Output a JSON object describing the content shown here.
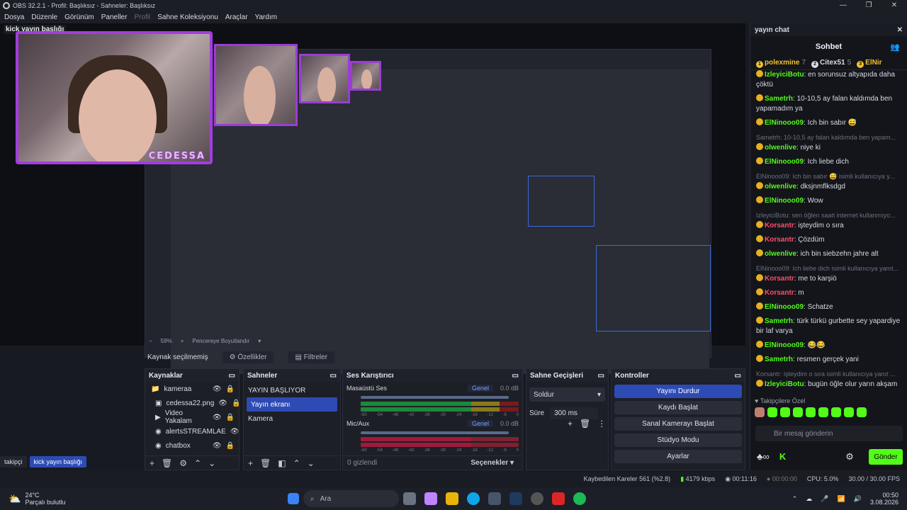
{
  "window": {
    "title": "OBS 32.2.1 - Profil: Başlıksız - Sahneler: Başlıksız",
    "controls": [
      "—",
      "❐",
      "✕"
    ]
  },
  "menu": [
    {
      "label": "Dosya",
      "disabled": false
    },
    {
      "label": "Düzenle",
      "disabled": false
    },
    {
      "label": "Görünüm",
      "disabled": false
    },
    {
      "label": "Paneller",
      "disabled": false
    },
    {
      "label": "Profil",
      "disabled": true
    },
    {
      "label": "Sahne Koleksiyonu",
      "disabled": false
    },
    {
      "label": "Araçlar",
      "disabled": false
    },
    {
      "label": "Yardım",
      "disabled": false
    }
  ],
  "preview": {
    "label": "kick yayın başlığı",
    "webcam_tag": "CEDESSA",
    "zoom": "59%",
    "fit": "Pencereye Boyutlandır"
  },
  "source_bar": {
    "status": "Kaynak seçilmemiş",
    "properties": "Özellikler",
    "filters": "Filtreler"
  },
  "sources": {
    "title": "Kaynaklar",
    "items": [
      {
        "name": "kameraa",
        "icon": "folder-icon"
      },
      {
        "name": "cedessa22.png",
        "icon": "image-icon"
      },
      {
        "name": "Video Yakalam",
        "icon": "camera-icon"
      },
      {
        "name": "alertsSTREAMLAE",
        "icon": "globe-icon"
      },
      {
        "name": "chatbox",
        "icon": "globe-icon"
      }
    ]
  },
  "scenes": {
    "title": "Sahneler",
    "items": [
      "YAYIN BAŞLIYOR",
      "Yayın ekranı",
      "Kamera"
    ],
    "selected": 1
  },
  "mixer": {
    "title": "Ses Karıştırıcı",
    "channels": [
      {
        "name": "Masaüstü Ses",
        "mode": "Genel",
        "db": "0.0 dB"
      },
      {
        "name": "Mic/Aux",
        "mode": "Genel",
        "db": "0.0 dB"
      }
    ],
    "ticks": [
      "-60",
      "-54",
      "-48",
      "-42",
      "-36",
      "-30",
      "-24",
      "-18",
      "-12",
      "-6",
      "0"
    ],
    "hidden": "0 gizlendi",
    "options": "Seçenekler"
  },
  "transitions": {
    "title": "Sahne Geçişleri",
    "type": "Soldur",
    "duration_label": "Süre",
    "duration": "300 ms"
  },
  "controls": {
    "title": "Kontroller",
    "buttons": [
      "Yayını Durdur",
      "Kaydı Başlat",
      "Sanal Kamerayı Başlat",
      "Stüdyo Modu",
      "Ayarlar"
    ]
  },
  "chat": {
    "dock_title": "yayın chat",
    "tab": "Sohbet",
    "leaders": [
      {
        "rank": "1",
        "name": "polexmine",
        "count": "7",
        "color": "#f0c330"
      },
      {
        "rank": "2",
        "name": "Citex51",
        "count": "5",
        "color": "#d8dde6"
      },
      {
        "rank": "3",
        "name": "ElNir",
        "count": "",
        "color": "#f0c330"
      }
    ],
    "messages": [
      {
        "reply": "",
        "user": "IzleyiciBotu",
        "color": "#53fc18",
        "text": "en sorunsuz altyapıda daha çöktü"
      },
      {
        "reply": "",
        "user": "Sametrh",
        "color": "#53fc18",
        "text": "10-10,5 ay falan kaldımda ben yapamadım ya"
      },
      {
        "reply": "",
        "user": "ElNinooo09",
        "color": "#53fc18",
        "text": "Ich bin sabır 😅"
      },
      {
        "reply": "Sametrh: 10-10,5 ay falan kaldımda ben yapam...",
        "user": "olwenlive",
        "color": "#53fc18",
        "text": "niye ki"
      },
      {
        "reply": "",
        "user": "ElNinooo09",
        "color": "#53fc18",
        "text": "Ich liebe dich"
      },
      {
        "reply": "ElNinooo09: Ich bin sabır 😅 isimli kullanıcıya y...",
        "user": "olwenlive",
        "color": "#53fc18",
        "text": "dksjnmflksdgd"
      },
      {
        "reply": "",
        "user": "ElNinooo09",
        "color": "#53fc18",
        "text": "Wow"
      },
      {
        "reply": "IzleyiciBotu: sen öğlen saati internet kullanmıyo...",
        "user": "Korsantr",
        "color": "#ff4d6a",
        "text": "işteydim o sıra"
      },
      {
        "reply": "",
        "user": "Korsantr",
        "color": "#ff4d6a",
        "text": "Çözdüm"
      },
      {
        "reply": "",
        "user": "olwenlive",
        "color": "#53fc18",
        "text": "ich bin siebzehn jahre alt"
      },
      {
        "reply": "ElNinooo09: Ich liebe dich isimli kullanıcıya yanıt...",
        "user": "Korsantr",
        "color": "#ff4d6a",
        "text": "me to karşiö"
      },
      {
        "reply": "",
        "user": "Korsantr",
        "color": "#ff4d6a",
        "text": "m"
      },
      {
        "reply": "",
        "user": "ElNinooo09",
        "color": "#53fc18",
        "text": "Schatze"
      },
      {
        "reply": "",
        "user": "Sametrh",
        "color": "#53fc18",
        "text": "türk türkü gurbette sey yapardiye bir laf varya"
      },
      {
        "reply": "",
        "user": "ElNinooo09",
        "color": "#53fc18",
        "text": "😂😂"
      },
      {
        "reply": "",
        "user": "Sametrh",
        "color": "#53fc18",
        "text": "resmen gerçek yani"
      },
      {
        "reply": "Korsantr: işteydim o sıra isimli kullanıcıya yanıt ...",
        "user": "IzleyiciBotu",
        "color": "#53fc18",
        "text": "bugün öğle olur yarın akşam"
      }
    ],
    "follower_special": "Takipçilere Özel",
    "input_placeholder": "Bir mesaj gönderin",
    "send": "Gönder"
  },
  "bottom_tabs": [
    {
      "label": "takipçi",
      "active": false
    },
    {
      "label": "kick yayın başlığı",
      "active": true
    }
  ],
  "status": {
    "dropped": "Kaybedilen Kareler 561 (%2.8)",
    "bitrate": "4179 kbps",
    "stream_time": "00:11:16",
    "rec_time": "00:00:00",
    "cpu": "CPU: 5.0%",
    "fps": "30.00 / 30.00 FPS"
  },
  "taskbar": {
    "temp": "24°C",
    "weather": "Parçalı bulutlu",
    "search": "Ara",
    "time": "00:50",
    "date": "3.08.2026"
  }
}
